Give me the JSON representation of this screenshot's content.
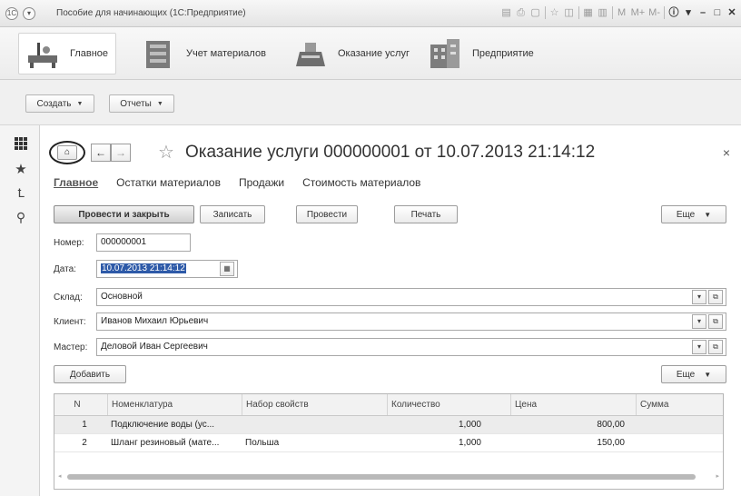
{
  "window": {
    "title": "Пособие для начинающих (1С:Предприятие)",
    "toolbar_m": "M",
    "toolbar_mplus": "M+",
    "toolbar_mminus": "M-"
  },
  "sections": [
    {
      "label": "Главное",
      "icon": "desk-icon"
    },
    {
      "label": "Учет материалов",
      "icon": "boxes-icon"
    },
    {
      "label": "Оказание услуг",
      "icon": "cash-register-icon"
    },
    {
      "label": "Предприятие",
      "icon": "building-icon"
    }
  ],
  "command_bar": {
    "create_label": "Создать",
    "reports_label": "Отчеты"
  },
  "form": {
    "title": "Оказание услуги 000000001 от 10.07.2013 21:14:12",
    "tabs": [
      "Главное",
      "Остатки материалов",
      "Продажи",
      "Стоимость материалов"
    ],
    "buttons": {
      "post_close": "Провести и закрыть",
      "write": "Записать",
      "post": "Провести",
      "print": "Печать",
      "more": "Еще",
      "add": "Добавить",
      "more2": "Еще"
    },
    "fields": {
      "number_label": "Номер:",
      "number_value": "000000001",
      "date_label": "Дата:",
      "date_value": "10.07.2013 21:14:12",
      "warehouse_label": "Склад:",
      "warehouse_value": "Основной",
      "client_label": "Клиент:",
      "client_value": "Иванов Михаил Юрьевич",
      "master_label": "Мастер:",
      "master_value": "Деловой Иван Сергеевич"
    },
    "table": {
      "columns": [
        "N",
        "Номенклатура",
        "Набор свойств",
        "Количество",
        "Цена",
        "Сумма"
      ],
      "rows": [
        {
          "n": "1",
          "item": "Подключение воды (ус...",
          "props": "",
          "qty": "1,000",
          "price": "800,00",
          "sum": ""
        },
        {
          "n": "2",
          "item": "Шланг резиновый (мате...",
          "props": "Польша",
          "qty": "1,000",
          "price": "150,00",
          "sum": ""
        }
      ]
    }
  }
}
